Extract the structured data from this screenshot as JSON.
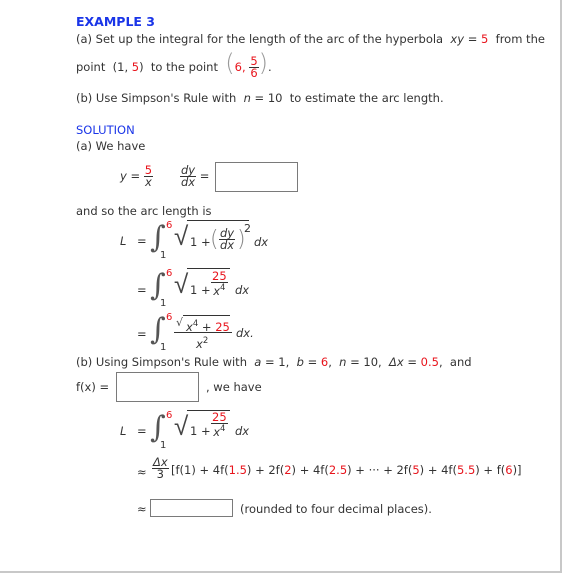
{
  "example": {
    "title": "EXAMPLE 3",
    "part_a_prompt": "(a) Set up the integral for the length of the arc of the hyperbola",
    "hyperbola_lhs": "xy",
    "hyperbola_eq": "=",
    "hyperbola_rhs": "5",
    "from_the": "from the",
    "point_text": "point",
    "point1_open": "(1,",
    "point1_y": "5",
    "point1_close": ")",
    "to_the_point": "to the point",
    "point2_x": "6,",
    "point2_num": "5",
    "point2_den": "6",
    "point2_end": ".",
    "part_b_prompt": "(b) Use Simpson's Rule with",
    "n_var": "n",
    "n_eq": "= 10",
    "part_b_suffix": "to estimate the arc length."
  },
  "solution": {
    "heading": "SOLUTION",
    "part_a_label": "(a) We have",
    "y_lhs": "y",
    "eq": "=",
    "y_num": "5",
    "y_den": "x",
    "dy": "dy",
    "dx": "dx",
    "dydx_answer": "",
    "arc_length_text": "and so the arc length is",
    "L": "L",
    "upper": "6",
    "lower": "1",
    "one_plus": "1 +",
    "sq": "2",
    "dx_suffix": "dx",
    "dx_suffix_period": "dx.",
    "frac_25": "25",
    "x4_base": "x",
    "x4_exp": "4",
    "plus_25": "+",
    "x2_base": "x",
    "x2_exp": "2",
    "part_b_label": "(b) Using Simpson's Rule with",
    "a_var": "a",
    "a_val": "= 1,",
    "b_var": "b",
    "b_eq": "=",
    "b_val": "6",
    "b_comma": ",",
    "n_var": "n",
    "n_val": "= 10,",
    "dx_var": "Δx",
    "dx_eq": "=",
    "dx_val": "0.5",
    "dx_tail": ",  and",
    "fx_label": "f(x) =",
    "fx_answer": "",
    "we_have": ", we have",
    "approx": "≈",
    "delta_x": "Δx",
    "three": "3",
    "simpson_terms": [
      {
        "t": "[f(1) + 4f(",
        "c": "n"
      },
      {
        "t": "1.5",
        "c": "r"
      },
      {
        "t": ") + 2f(",
        "c": "n"
      },
      {
        "t": "2",
        "c": "r"
      },
      {
        "t": ") + 4f(",
        "c": "n"
      },
      {
        "t": "2.5",
        "c": "r"
      },
      {
        "t": ") + ··· + 2f(",
        "c": "n"
      },
      {
        "t": "5",
        "c": "r"
      },
      {
        "t": ") + 4f(",
        "c": "n"
      },
      {
        "t": "5.5",
        "c": "r"
      },
      {
        "t": ") + f(",
        "c": "n"
      },
      {
        "t": "6",
        "c": "r"
      },
      {
        "t": ")]",
        "c": "n"
      }
    ],
    "final_answer": "",
    "rounded_note": "(rounded to four decimal places)."
  },
  "colors": {
    "heading_blue": "#1a35e8",
    "value_red": "#e8141c",
    "text": "#333333",
    "input_border": "#7a7a7a"
  }
}
